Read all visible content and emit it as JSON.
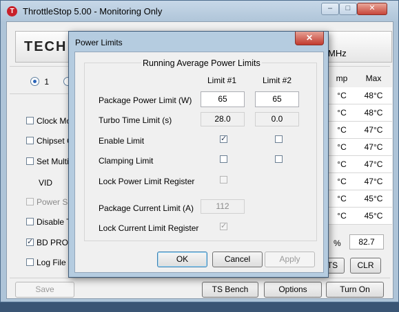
{
  "main": {
    "title": "ThrottleStop 5.00 - Monitoring Only",
    "app_icon_glyph": "T",
    "logo_text": "TECH",
    "mhz_text": "MHz",
    "radio_value": "1",
    "options": [
      {
        "label": "Clock Mod",
        "checked": false,
        "enabled": true
      },
      {
        "label": "Chipset C",
        "checked": false,
        "enabled": true
      },
      {
        "label": "Set Multip",
        "checked": false,
        "enabled": true
      },
      {
        "label": "Power Sav",
        "checked": false,
        "enabled": false
      },
      {
        "label": "Disable Tu",
        "checked": false,
        "enabled": true
      },
      {
        "label": "BD PROCH",
        "checked": true,
        "enabled": true
      },
      {
        "label": "Log File",
        "checked": false,
        "enabled": true
      }
    ],
    "vid_label": "VID",
    "temp_table": {
      "header_a": "mp",
      "header_b": "Max",
      "rows": [
        {
          "a": "°C",
          "b": "48°C"
        },
        {
          "a": "°C",
          "b": "48°C"
        },
        {
          "a": "°C",
          "b": "47°C"
        },
        {
          "a": "°C",
          "b": "47°C"
        },
        {
          "a": "°C",
          "b": "47°C"
        },
        {
          "a": "°C",
          "b": "47°C"
        },
        {
          "a": "°C",
          "b": "45°C"
        },
        {
          "a": "°C",
          "b": "45°C"
        }
      ]
    },
    "percent_symbol": "%",
    "percent_value": "82.7",
    "buttons": {
      "ts_partial": "TS",
      "clr": "CLR",
      "save": "Save",
      "ts_bench": "TS Bench",
      "options": "Options",
      "turn_on": "Turn On"
    }
  },
  "dialog": {
    "title": "Power Limits",
    "close_glyph": "✕",
    "group_title": "Running Average Power Limits",
    "col1": "Limit #1",
    "col2": "Limit #2",
    "rows": {
      "package_power_limit": {
        "label": "Package Power Limit (W)",
        "v1": "65",
        "v2": "65"
      },
      "turbo_time_limit": {
        "label": "Turbo Time Limit (s)",
        "v1": "28.0",
        "v2": "0.0"
      },
      "enable_limit": {
        "label": "Enable Limit",
        "c1": true,
        "c2": false
      },
      "clamping_limit": {
        "label": "Clamping Limit",
        "c1": false,
        "c2": false
      },
      "lock_power_limit_register": {
        "label": "Lock Power Limit Register",
        "c1": false
      },
      "package_current_limit": {
        "label": "Package Current Limit (A)",
        "v1": "112"
      },
      "lock_current_limit_register": {
        "label": "Lock Current Limit Register",
        "c1": true
      }
    },
    "buttons": {
      "ok": "OK",
      "cancel": "Cancel",
      "apply": "Apply"
    }
  }
}
